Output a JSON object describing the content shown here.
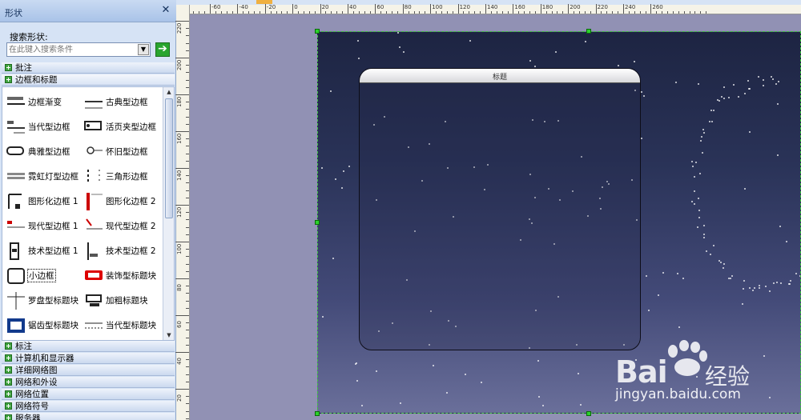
{
  "panel": {
    "title": "形状",
    "close_glyph": "✕",
    "search_label": "搜索形状:",
    "search_placeholder": "在此键入搜索条件",
    "search_go_glyph": "➔",
    "categories_top": [
      {
        "label": "批注",
        "open": false
      },
      {
        "label": "边框和标题",
        "open": true
      }
    ],
    "shapes": [
      {
        "label": "边框渐变",
        "icon": "border-gradient-icon"
      },
      {
        "label": "古典型边框",
        "icon": "classic-border-icon"
      },
      {
        "label": "当代型边框",
        "icon": "contemporary-border-icon"
      },
      {
        "label": "活页夹型边框",
        "icon": "binder-border-icon"
      },
      {
        "label": "典雅型边框",
        "icon": "elegant-border-icon"
      },
      {
        "label": "怀旧型边框",
        "icon": "retro-border-icon"
      },
      {
        "label": "霓虹灯型边框",
        "icon": "neon-border-icon"
      },
      {
        "label": "三角形边框",
        "icon": "triangle-border-icon"
      },
      {
        "label": "图形化边框 1",
        "icon": "graphic-border-1-icon"
      },
      {
        "label": "图形化边框 2",
        "icon": "graphic-border-2-icon"
      },
      {
        "label": "现代型边框 1",
        "icon": "modern-border-1-icon"
      },
      {
        "label": "现代型边框 2",
        "icon": "modern-border-2-icon"
      },
      {
        "label": "技术型边框 1",
        "icon": "technical-border-1-icon"
      },
      {
        "label": "技术型边框 2",
        "icon": "technical-border-2-icon"
      },
      {
        "label": "小边框",
        "icon": "small-border-icon",
        "selected": true
      },
      {
        "label": "装饰型标题块",
        "icon": "decorative-title-block-icon"
      },
      {
        "label": "罗盘型标题块",
        "icon": "compass-title-block-icon"
      },
      {
        "label": "加粗标题块",
        "icon": "bold-title-block-icon"
      },
      {
        "label": "锯齿型标题块",
        "icon": "zigzag-title-block-icon"
      },
      {
        "label": "当代型标题块",
        "icon": "contemporary-title-block-icon"
      }
    ],
    "categories_bottom": [
      {
        "label": "标注"
      },
      {
        "label": "计算机和显示器"
      },
      {
        "label": "详细网络图"
      },
      {
        "label": "网络和外设"
      },
      {
        "label": "网络位置"
      },
      {
        "label": "网络符号"
      },
      {
        "label": "服务器"
      }
    ]
  },
  "rulers": {
    "h_labels": [
      "-60",
      "-40",
      "-20",
      "0",
      "20",
      "40",
      "60",
      "80",
      "100",
      "120",
      "140",
      "160",
      "180",
      "200",
      "220",
      "240",
      "260"
    ],
    "v_labels": [
      "220",
      "200",
      "180",
      "160",
      "140",
      "120",
      "100",
      "80",
      "60",
      "40",
      "20"
    ]
  },
  "canvas": {
    "frame_title": "标题"
  },
  "watermark": {
    "brand": "Bai",
    "brand_suffix": "经验",
    "url": "jingyan.baidu.com"
  },
  "colors": {
    "panel_bg": "#d6e3f5",
    "page_top": "#1d2442",
    "page_bottom": "#6a6f9a",
    "selection_handle": "#2bd12b"
  }
}
